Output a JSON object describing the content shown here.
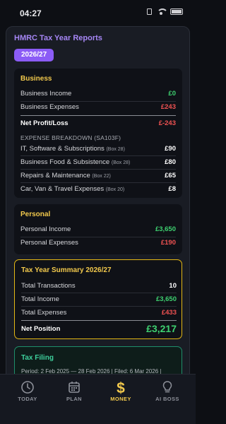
{
  "status_bar": {
    "time": "04:27"
  },
  "report": {
    "title": "HMRC Tax Year Reports",
    "year_pill": "2026/27"
  },
  "business": {
    "title": "Business",
    "income_label": "Business Income",
    "income_value": "£0",
    "expenses_label": "Business Expenses",
    "expenses_value": "£243",
    "net_label": "Net Profit/Loss",
    "net_value": "£-243",
    "breakdown_label": "EXPENSE BREAKDOWN (SA103F)",
    "breakdown": [
      {
        "label": "IT, Software & Subscriptions",
        "box": "(Box 28)",
        "value": "£90"
      },
      {
        "label": "Business Food & Subsistence",
        "box": "(Box 28)",
        "value": "£80"
      },
      {
        "label": "Repairs & Maintenance",
        "box": "(Box 22)",
        "value": "£65"
      },
      {
        "label": "Car, Van & Travel Expenses",
        "box": "(Box 20)",
        "value": "£8"
      }
    ]
  },
  "personal": {
    "title": "Personal",
    "income_label": "Personal Income",
    "income_value": "£3,650",
    "expenses_label": "Personal Expenses",
    "expenses_value": "£190"
  },
  "summary": {
    "title": "Tax Year Summary 2026/27",
    "transactions_label": "Total Transactions",
    "transactions_value": "10",
    "income_label": "Total Income",
    "income_value": "£3,650",
    "expenses_label": "Total Expenses",
    "expenses_value": "£433",
    "net_label": "Net Position",
    "net_value": "£3,217"
  },
  "filing": {
    "title": "Tax Filing",
    "text": "Period: 2 Feb 2025 — 28 Feb 2026 | Filed: 6 Mar 2026 |"
  },
  "tabs": [
    {
      "label": "TODAY",
      "icon": "clock-icon",
      "active": false
    },
    {
      "label": "PLAN",
      "icon": "calendar-icon",
      "active": false
    },
    {
      "label": "MONEY",
      "icon": "dollar-icon",
      "active": true
    },
    {
      "label": "AI BOSS",
      "icon": "lightbulb-icon",
      "active": false
    }
  ],
  "colors": {
    "accent_purple": "#8b5cf6",
    "accent_yellow": "#f2c94c",
    "positive_green": "#3ed170",
    "negative_red": "#f05252",
    "filing_teal": "#3ed19d"
  }
}
